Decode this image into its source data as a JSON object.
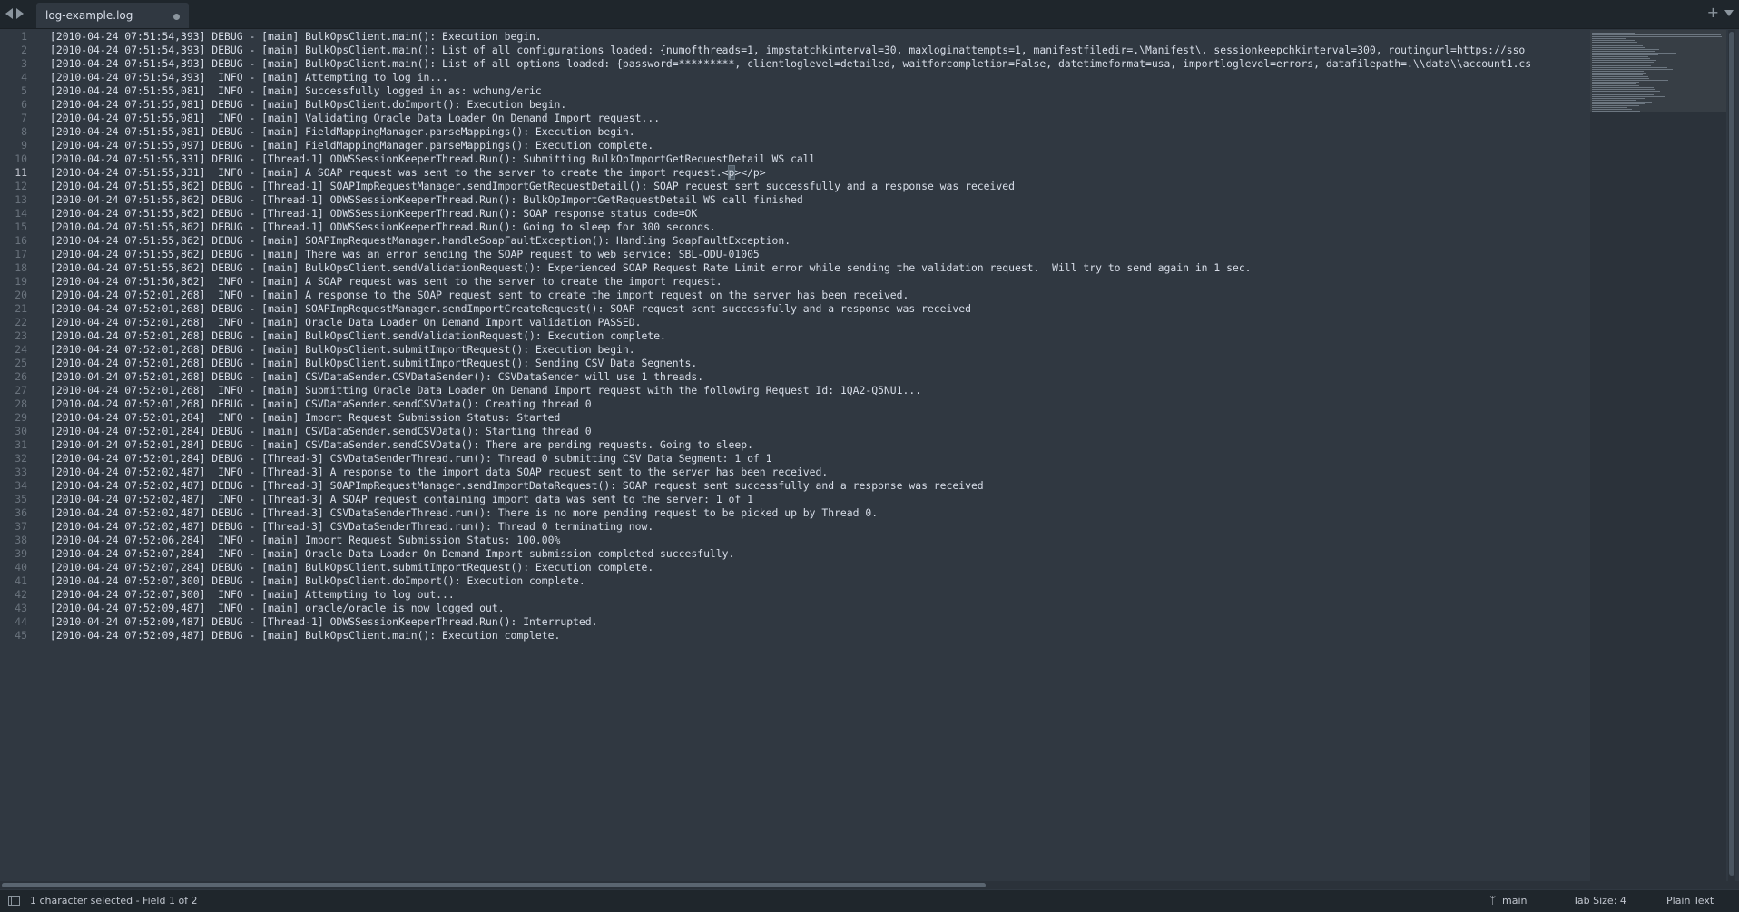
{
  "tab": {
    "title": "log-example.log"
  },
  "lines": [
    {
      "n": "1",
      "text": "[2010-04-24 07:51:54,393] DEBUG - [main] BulkOpsClient.main(): Execution begin."
    },
    {
      "n": "2",
      "text": "[2010-04-24 07:51:54,393] DEBUG - [main] BulkOpsClient.main(): List of all configurations loaded: {numofthreads=1, impstatchkinterval=30, maxloginattempts=1, manifestfiledir=.\\Manifest\\, sessionkeepchkinterval=300, routingurl=https://sso"
    },
    {
      "n": "3",
      "text": "[2010-04-24 07:51:54,393] DEBUG - [main] BulkOpsClient.main(): List of all options loaded: {password=*********, clientloglevel=detailed, waitforcompletion=False, datetimeformat=usa, importloglevel=errors, datafilepath=.\\\\data\\\\account1.cs"
    },
    {
      "n": "4",
      "text": "[2010-04-24 07:51:54,393]  INFO - [main] Attempting to log in..."
    },
    {
      "n": "5",
      "text": "[2010-04-24 07:51:55,081]  INFO - [main] Successfully logged in as: wchung/eric"
    },
    {
      "n": "6",
      "text": "[2010-04-24 07:51:55,081] DEBUG - [main] BulkOpsClient.doImport(): Execution begin."
    },
    {
      "n": "7",
      "text": "[2010-04-24 07:51:55,081]  INFO - [main] Validating Oracle Data Loader On Demand Import request..."
    },
    {
      "n": "8",
      "text": "[2010-04-24 07:51:55,081] DEBUG - [main] FieldMappingManager.parseMappings(): Execution begin."
    },
    {
      "n": "9",
      "text": "[2010-04-24 07:51:55,097] DEBUG - [main] FieldMappingManager.parseMappings(): Execution complete."
    },
    {
      "n": "10",
      "text": "[2010-04-24 07:51:55,331] DEBUG - [Thread-1] ODWSSessionKeeperThread.Run(): Submitting BulkOpImportGetRequestDetail WS call"
    },
    {
      "n": "11",
      "pre": "[2010-04-24 07:51:55,331]  INFO - [main] A SOAP request was sent to the server to create the import request.<",
      "mid": "p",
      "post": "></p>"
    },
    {
      "n": "12",
      "text": "[2010-04-24 07:51:55,862] DEBUG - [Thread-1] SOAPImpRequestManager.sendImportGetRequestDetail(): SOAP request sent successfully and a response was received"
    },
    {
      "n": "13",
      "text": "[2010-04-24 07:51:55,862] DEBUG - [Thread-1] ODWSSessionKeeperThread.Run(): BulkOpImportGetRequestDetail WS call finished"
    },
    {
      "n": "14",
      "text": "[2010-04-24 07:51:55,862] DEBUG - [Thread-1] ODWSSessionKeeperThread.Run(): SOAP response status code=OK"
    },
    {
      "n": "15",
      "text": "[2010-04-24 07:51:55,862] DEBUG - [Thread-1] ODWSSessionKeeperThread.Run(): Going to sleep for 300 seconds."
    },
    {
      "n": "16",
      "text": "[2010-04-24 07:51:55,862] DEBUG - [main] SOAPImpRequestManager.handleSoapFaultException(): Handling SoapFaultException."
    },
    {
      "n": "17",
      "text": "[2010-04-24 07:51:55,862] DEBUG - [main] There was an error sending the SOAP request to web service: SBL-ODU-01005"
    },
    {
      "n": "18",
      "text": "[2010-04-24 07:51:55,862] DEBUG - [main] BulkOpsClient.sendValidationRequest(): Experienced SOAP Request Rate Limit error while sending the validation request.  Will try to send again in 1 sec."
    },
    {
      "n": "19",
      "text": "[2010-04-24 07:51:56,862]  INFO - [main] A SOAP request was sent to the server to create the import request."
    },
    {
      "n": "20",
      "text": "[2010-04-24 07:52:01,268]  INFO - [main] A response to the SOAP request sent to create the import request on the server has been received."
    },
    {
      "n": "21",
      "text": "[2010-04-24 07:52:01,268] DEBUG - [main] SOAPImpRequestManager.sendImportCreateRequest(): SOAP request sent successfully and a response was received"
    },
    {
      "n": "22",
      "text": "[2010-04-24 07:52:01,268]  INFO - [main] Oracle Data Loader On Demand Import validation PASSED."
    },
    {
      "n": "23",
      "text": "[2010-04-24 07:52:01,268] DEBUG - [main] BulkOpsClient.sendValidationRequest(): Execution complete."
    },
    {
      "n": "24",
      "text": "[2010-04-24 07:52:01,268] DEBUG - [main] BulkOpsClient.submitImportRequest(): Execution begin."
    },
    {
      "n": "25",
      "text": "[2010-04-24 07:52:01,268] DEBUG - [main] BulkOpsClient.submitImportRequest(): Sending CSV Data Segments."
    },
    {
      "n": "26",
      "text": "[2010-04-24 07:52:01,268] DEBUG - [main] CSVDataSender.CSVDataSender(): CSVDataSender will use 1 threads."
    },
    {
      "n": "27",
      "text": "[2010-04-24 07:52:01,268]  INFO - [main] Submitting Oracle Data Loader On Demand Import request with the following Request Id: 1QA2-Q5NU1..."
    },
    {
      "n": "28",
      "text": "[2010-04-24 07:52:01,268] DEBUG - [main] CSVDataSender.sendCSVData(): Creating thread 0"
    },
    {
      "n": "29",
      "text": "[2010-04-24 07:52:01,284]  INFO - [main] Import Request Submission Status: Started"
    },
    {
      "n": "30",
      "text": "[2010-04-24 07:52:01,284] DEBUG - [main] CSVDataSender.sendCSVData(): Starting thread 0"
    },
    {
      "n": "31",
      "text": "[2010-04-24 07:52:01,284] DEBUG - [main] CSVDataSender.sendCSVData(): There are pending requests. Going to sleep."
    },
    {
      "n": "32",
      "text": "[2010-04-24 07:52:01,284] DEBUG - [Thread-3] CSVDataSenderThread.run(): Thread 0 submitting CSV Data Segment: 1 of 1"
    },
    {
      "n": "33",
      "text": "[2010-04-24 07:52:02,487]  INFO - [Thread-3] A response to the import data SOAP request sent to the server has been received."
    },
    {
      "n": "34",
      "text": "[2010-04-24 07:52:02,487] DEBUG - [Thread-3] SOAPImpRequestManager.sendImportDataRequest(): SOAP request sent successfully and a response was received"
    },
    {
      "n": "35",
      "text": "[2010-04-24 07:52:02,487]  INFO - [Thread-3] A SOAP request containing import data was sent to the server: 1 of 1"
    },
    {
      "n": "36",
      "text": "[2010-04-24 07:52:02,487] DEBUG - [Thread-3] CSVDataSenderThread.run(): There is no more pending request to be picked up by Thread 0."
    },
    {
      "n": "37",
      "text": "[2010-04-24 07:52:02,487] DEBUG - [Thread-3] CSVDataSenderThread.run(): Thread 0 terminating now."
    },
    {
      "n": "38",
      "text": "[2010-04-24 07:52:06,284]  INFO - [main] Import Request Submission Status: 100.00%"
    },
    {
      "n": "39",
      "text": "[2010-04-24 07:52:07,284]  INFO - [main] Oracle Data Loader On Demand Import submission completed succesfully."
    },
    {
      "n": "40",
      "text": "[2010-04-24 07:52:07,284] DEBUG - [main] BulkOpsClient.submitImportRequest(): Execution complete."
    },
    {
      "n": "41",
      "text": "[2010-04-24 07:52:07,300] DEBUG - [main] BulkOpsClient.doImport(): Execution complete."
    },
    {
      "n": "42",
      "text": "[2010-04-24 07:52:07,300]  INFO - [main] Attempting to log out..."
    },
    {
      "n": "43",
      "text": "[2010-04-24 07:52:09,487]  INFO - [main] oracle/oracle is now logged out."
    },
    {
      "n": "44",
      "text": "[2010-04-24 07:52:09,487] DEBUG - [Thread-1] ODWSSessionKeeperThread.Run(): Interrupted."
    },
    {
      "n": "45",
      "text": "[2010-04-24 07:52:09,487] DEBUG - [main] BulkOpsClient.main(): Execution complete."
    }
  ],
  "current_line": "11",
  "status": {
    "selection": "1 character selected - Field 1 of 2",
    "branch": "main",
    "tab_size": "Tab Size: 4",
    "syntax": "Plain Text"
  },
  "icons": {
    "nav_back": "chevron-left-icon",
    "nav_forward": "chevron-right-icon",
    "new_tab": "plus-icon",
    "tab_menu": "chevron-down-icon",
    "dirty": "unsaved-dot-icon",
    "panel": "sidebar-toggle-icon",
    "branch": "git-branch-icon"
  },
  "colors": {
    "editor_bg": "#303841",
    "tabbar_bg": "#1f262c",
    "text": "#d8dee9",
    "gutter": "#6a737d",
    "selection": "#4f5b66"
  }
}
